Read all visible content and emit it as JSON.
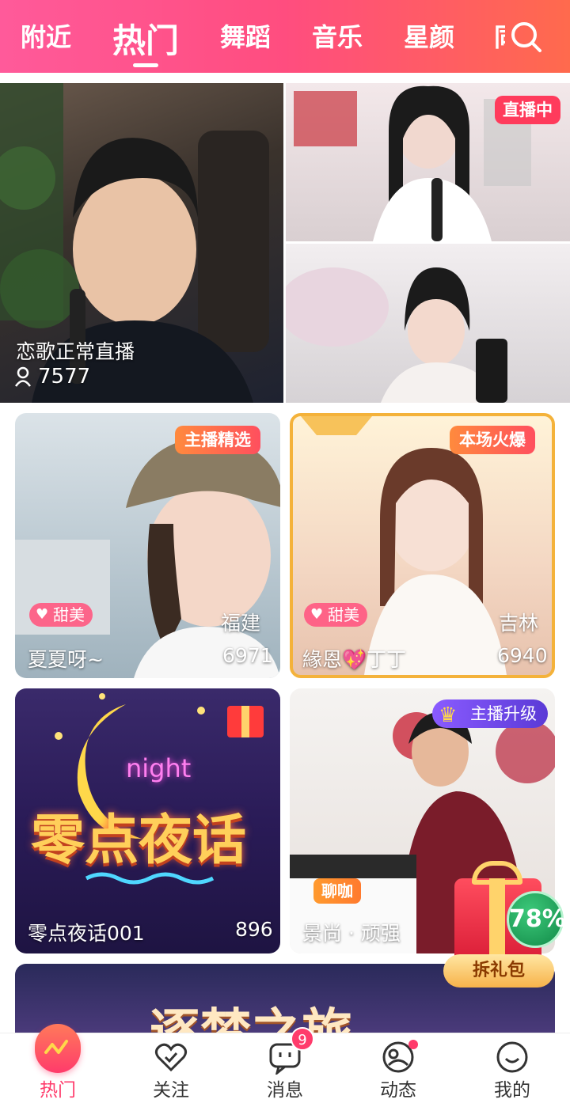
{
  "tabs": [
    {
      "label": "附近",
      "active": false
    },
    {
      "label": "热门",
      "active": true
    },
    {
      "label": "舞蹈",
      "active": false
    },
    {
      "label": "音乐",
      "active": false
    },
    {
      "label": "星颜",
      "active": false
    }
  ],
  "tab_partial": "同",
  "cards": {
    "featured": {
      "title": "恋歌正常直播",
      "viewers": "7577"
    },
    "top_right": {
      "badge": "直播中"
    },
    "card1": {
      "badge": "主播精选",
      "tag": "甜美",
      "location": "福建",
      "name": "夏夏呀~",
      "count": "6971"
    },
    "card2": {
      "badge": "本场火爆",
      "tag": "甜美",
      "location": "吉林",
      "name": "緣恩💖丁丁",
      "count": "6940"
    },
    "card3": {
      "poster_sub": "night",
      "poster_title": "零点夜话",
      "name": "零点夜话001",
      "count": "896"
    },
    "card4": {
      "badge": "主播升级",
      "tag": "聊咖",
      "name": "景尚 · 顽强"
    },
    "banner": {
      "text": "逐梦之旅"
    }
  },
  "gift": {
    "percent": "78%",
    "button": "拆礼包"
  },
  "bottom_nav": [
    {
      "label": "热门",
      "icon": "flame-icon",
      "active": true
    },
    {
      "label": "关注",
      "icon": "heart-check-icon"
    },
    {
      "label": "消息",
      "icon": "message-icon",
      "badge": "9"
    },
    {
      "label": "动态",
      "icon": "moments-icon",
      "dot": true
    },
    {
      "label": "我的",
      "icon": "smile-icon"
    }
  ],
  "colors": {
    "accent": "#ff4d7f",
    "gradient_end": "#ff6a4d",
    "live_badge": "#ff3b5c",
    "gift_green": "#1fa85c"
  }
}
